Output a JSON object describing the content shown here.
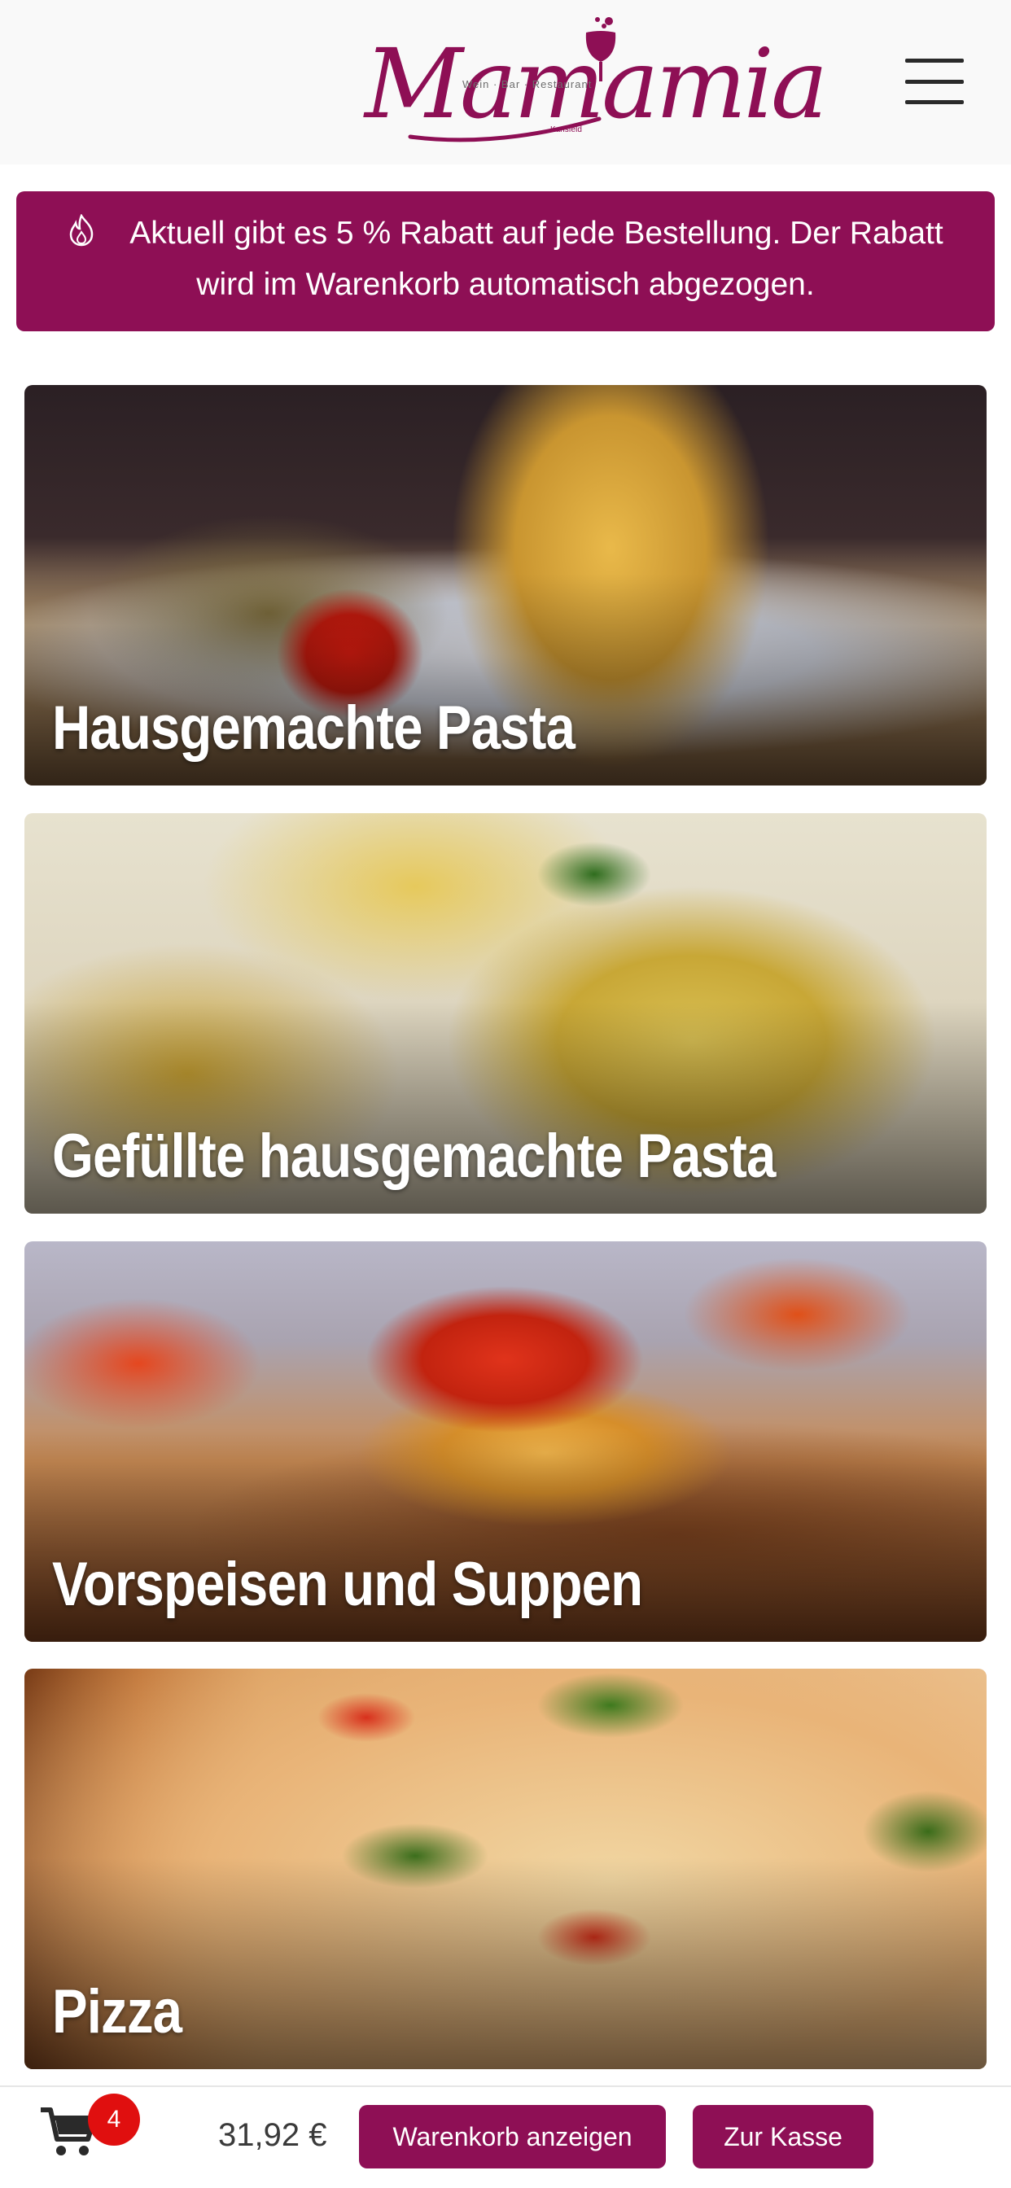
{
  "header": {
    "logo": {
      "wordmark": "Mamamia",
      "tagline": "Wein · Bar · Restaurant",
      "subline": "Karlsfeld"
    },
    "menu_icon": "hamburger-menu-icon"
  },
  "promo": {
    "icon": "flame-icon",
    "text": "Aktuell gibt es 5 % Rabatt auf jede Bestellung. Der Rabatt wird im Warenkorb automatisch abgezogen."
  },
  "categories": [
    {
      "label": "Hausgemachte Pasta"
    },
    {
      "label": "Gefüllte hausgemachte Pasta"
    },
    {
      "label": "Vorspeisen und Suppen"
    },
    {
      "label": "Pizza"
    }
  ],
  "cart": {
    "icon": "shopping-cart-icon",
    "count": "4",
    "total": "31,92 €",
    "view_cart_label": "Warenkorb anzeigen",
    "checkout_label": "Zur Kasse"
  },
  "colors": {
    "brand": "#8e0f55",
    "badge": "#e00f0f",
    "header_bg": "#f9f9f9"
  }
}
